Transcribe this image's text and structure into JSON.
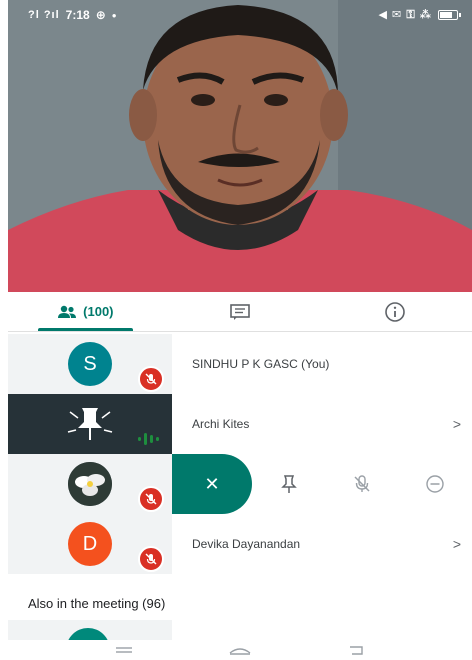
{
  "status_bar": {
    "time": "7:18",
    "signal_text": "?l ?ıl",
    "right_glyphs": "◀ ✉ ⚿ ⁂",
    "battery_level": 0.8
  },
  "tabs": [
    {
      "name": "people",
      "label": "(100)",
      "active": true
    },
    {
      "name": "chat",
      "label": "",
      "active": false
    },
    {
      "name": "info",
      "label": "",
      "active": false
    }
  ],
  "participants": [
    {
      "initial": "S",
      "avatar_color": "#00838f",
      "name": "SINDHU P K GASC (You)",
      "muted": true,
      "chevron": false
    },
    {
      "initial": "",
      "avatar_color": "#263238",
      "name": "Archi Kites",
      "muted": false,
      "speaking": true,
      "chevron": true,
      "chevron_glyph": ">"
    },
    {
      "initial": "",
      "avatar_color": "#455a64",
      "name": "",
      "muted": true,
      "chevron": false,
      "actions_open": true
    },
    {
      "initial": "D",
      "avatar_color": "#f4511e",
      "name": "Devika Dayanandan",
      "muted": true,
      "chevron": true,
      "chevron_glyph": ">"
    }
  ],
  "row_actions": {
    "close_icon": "close-icon",
    "pin_icon": "pin-icon",
    "mute_icon": "mic-off-icon",
    "remove_icon": "remove-icon",
    "close_glyph": "✕"
  },
  "also_in_meeting": {
    "label": "Also in the meeting (96)"
  },
  "colors": {
    "accent": "#00796b",
    "mute_red": "#d93025",
    "speaking_green": "#1e8e3e"
  }
}
